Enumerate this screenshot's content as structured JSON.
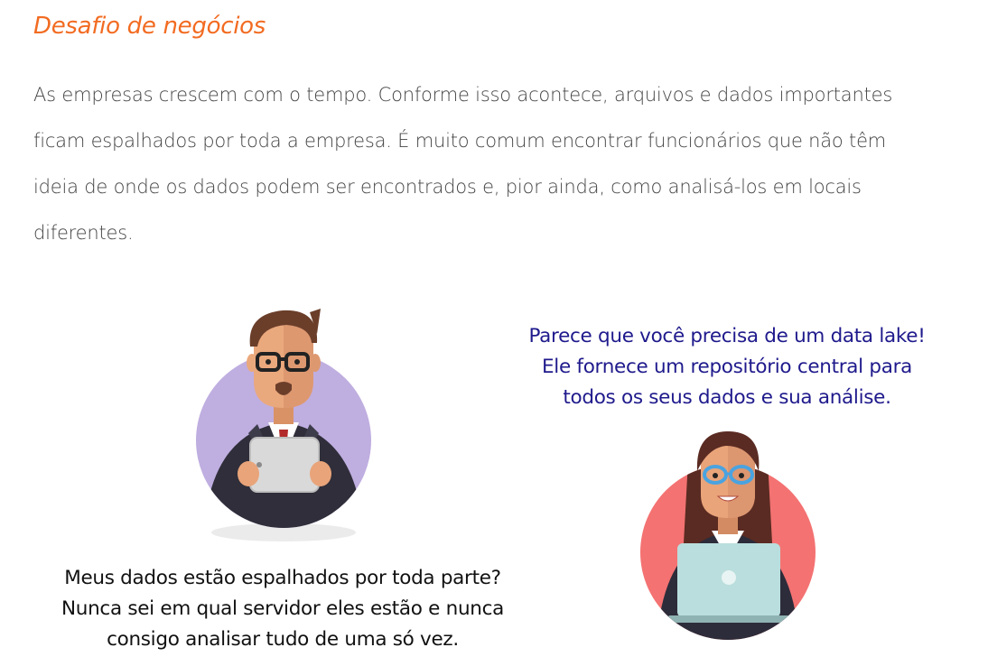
{
  "section": {
    "title": "Desafio de negócios",
    "paragraph_lines": [
      "As empresas crescem com o tempo. Conforme isso acontece, arquivos e dados importantes",
      "ficam espalhados por toda a empresa. É muito comum encontrar funcionários que não têm",
      "ideia de onde os dados podem ser encontrados e, pior ainda, como analisá-los em locais",
      "diferentes."
    ]
  },
  "illustration": {
    "man_caption_lines": [
      "Meus dados estão espalhados por toda parte?",
      "Nunca sei em qual servidor eles estão e nunca",
      "consigo analisar tudo de uma só vez."
    ],
    "woman_caption_lines": [
      "Parece que você precisa de um data lake!",
      "Ele fornece um repositório central para",
      "todos os seus dados e sua análise."
    ],
    "colors": {
      "heading": "#f26b21",
      "man_circle": "#bfaee0",
      "woman_circle": "#f47272",
      "woman_caption": "#1f1a8c"
    }
  }
}
